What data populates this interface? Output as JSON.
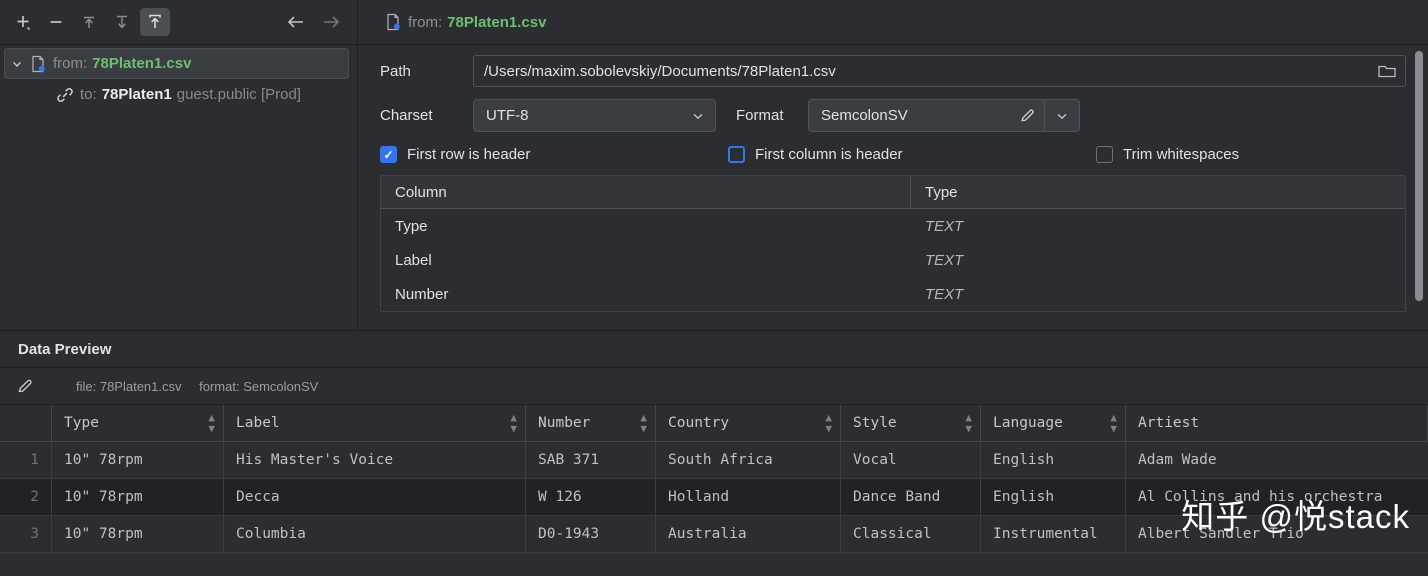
{
  "toolbar": {
    "buttons": [
      {
        "name": "add",
        "icon": "plus-icon"
      },
      {
        "name": "remove",
        "icon": "minus-icon"
      },
      {
        "name": "move-up",
        "icon": "arrow-up-to-line-icon"
      },
      {
        "name": "move-down",
        "icon": "arrow-down-to-line-icon"
      },
      {
        "name": "import",
        "icon": "import-upload-icon"
      }
    ],
    "nav_back": "back-arrow-icon",
    "nav_forward": "forward-arrow-icon"
  },
  "tree": {
    "parent": {
      "prefix": "from:",
      "file": "78Platen1.csv",
      "icon": "csv-file-icon",
      "chevron": "chevron-down-icon"
    },
    "child": {
      "icon": "link-icon",
      "prefix": "to:",
      "target": "78Platen1",
      "schema": "guest.public [Prod]"
    }
  },
  "settings": {
    "header": {
      "icon": "csv-file-icon",
      "prefix": "from:",
      "file": "78Platen1.csv"
    },
    "path": {
      "label": "Path",
      "value": "/Users/maxim.sobolevskiy/Documents/78Platen1.csv",
      "browse_icon": "folder-icon"
    },
    "charset": {
      "label": "Charset",
      "value": "UTF-8",
      "arrow_icon": "chevron-down-icon"
    },
    "format": {
      "label": "Format",
      "value": "SemcolonSV",
      "edit_icon": "pencil-icon",
      "arrow_icon": "chevron-down-icon"
    },
    "checkboxes": [
      {
        "label": "First row is header",
        "checked": true,
        "focused": false
      },
      {
        "label": "First column is header",
        "checked": false,
        "focused": true
      },
      {
        "label": "Trim whitespaces",
        "checked": false,
        "focused": false
      }
    ],
    "columns_table": {
      "headers": [
        "Column",
        "Type"
      ],
      "rows": [
        {
          "column": "Type",
          "type": "TEXT"
        },
        {
          "column": "Label",
          "type": "TEXT"
        },
        {
          "column": "Number",
          "type": "TEXT"
        }
      ]
    }
  },
  "preview": {
    "title": "Data Preview",
    "meta_icon": "pencil-icon",
    "meta_file_label": "file: 78Platen1.csv",
    "meta_format_label": "format: SemcolonSV",
    "columns": [
      "Type",
      "Label",
      "Number",
      "Country",
      "Style",
      "Language",
      "Artiest"
    ],
    "rows": [
      {
        "n": "1",
        "cells": [
          "10\" 78rpm",
          "His Master's Voice",
          "SAB 371",
          "South Africa",
          "Vocal",
          "English",
          "Adam Wade"
        ]
      },
      {
        "n": "2",
        "cells": [
          "10\" 78rpm",
          "Decca",
          "W 126",
          "Holland",
          "Dance Band",
          "English",
          "Al Collins and his orchestra"
        ]
      },
      {
        "n": "3",
        "cells": [
          "10\" 78rpm",
          "Columbia",
          "D0-1943",
          "Australia",
          "Classical",
          "Instrumental",
          "Albert Sandler Trio"
        ]
      }
    ]
  },
  "watermark": "知乎 @悦stack",
  "colors": {
    "accent_blue": "#3574f0",
    "file_green": "#6fbf73",
    "panel_bg": "#2b2d30",
    "grid_alt": "#212226"
  }
}
